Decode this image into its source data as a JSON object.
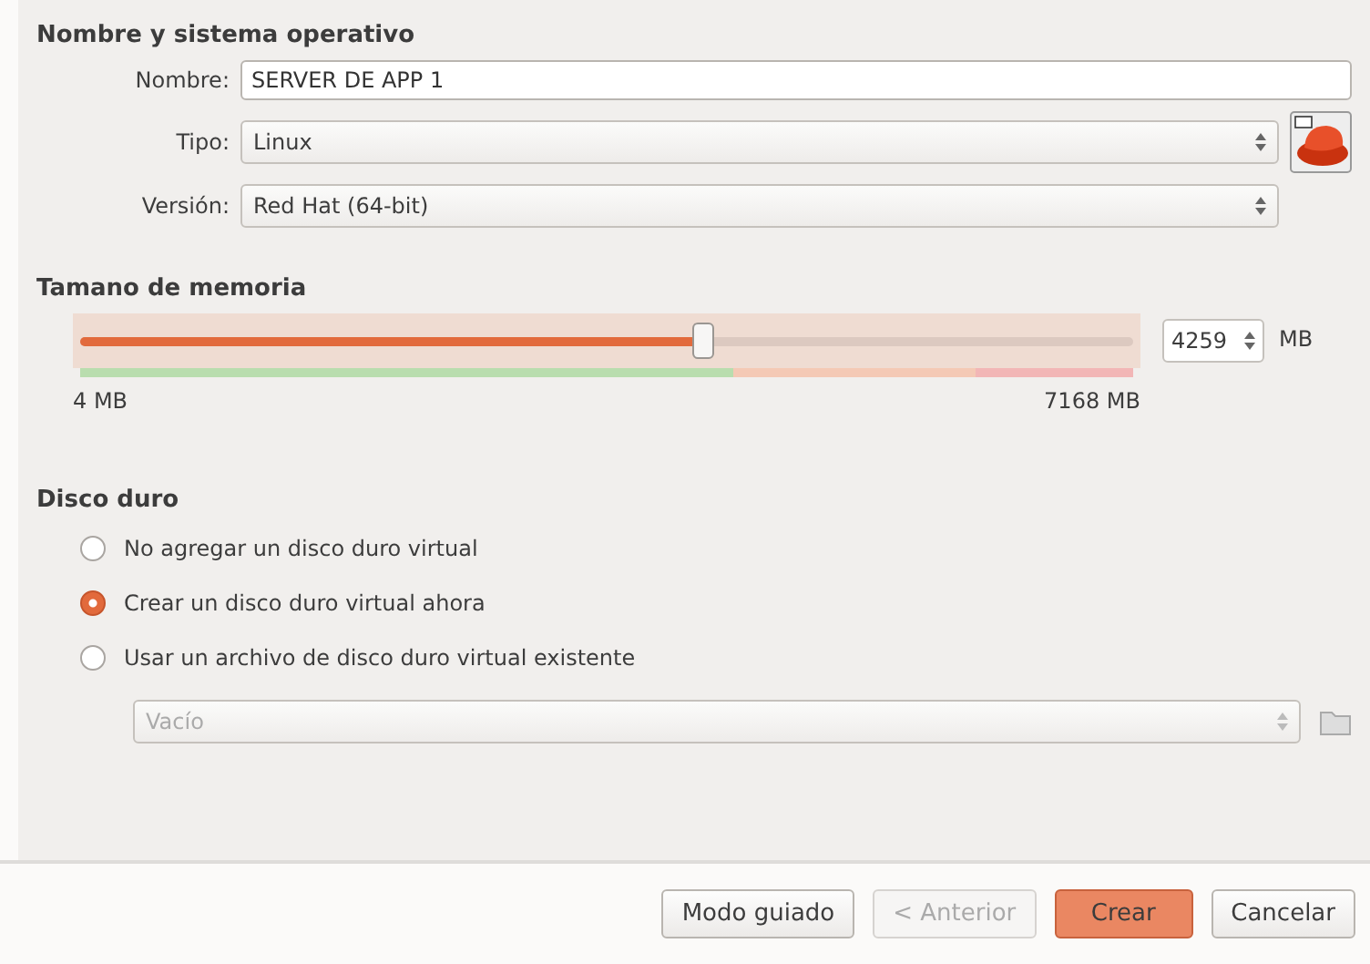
{
  "name_os": {
    "heading": "Nombre y sistema operativo",
    "name": {
      "label": "Nombre:",
      "value": "SERVER DE APP 1"
    },
    "type": {
      "label": "Tipo:",
      "value": "Linux"
    },
    "version": {
      "label": "Versión:",
      "value": "Red Hat (64-bit)"
    }
  },
  "memory": {
    "heading": "Tamano de memoria",
    "level": 0.594,
    "value": "4259",
    "unit": "MB",
    "min_label": "4 MB",
    "max_label": "7168 MB"
  },
  "disk": {
    "heading": "Disco duro",
    "options": [
      {
        "label": "No agregar un disco duro virtual",
        "selected": false
      },
      {
        "label": "Crear un disco duro virtual ahora",
        "selected": true
      },
      {
        "label": "Usar un archivo de disco duro virtual existente",
        "selected": false
      }
    ],
    "file": {
      "value": "Vacío",
      "disabled": true
    }
  },
  "buttons": [
    {
      "label": "Modo guiado",
      "disabled": false,
      "default": false
    },
    {
      "label": "< Anterior",
      "disabled": true,
      "default": false
    },
    {
      "label": "Crear",
      "disabled": false,
      "default": true
    },
    {
      "label": "Cancelar",
      "disabled": false,
      "default": false
    }
  ]
}
